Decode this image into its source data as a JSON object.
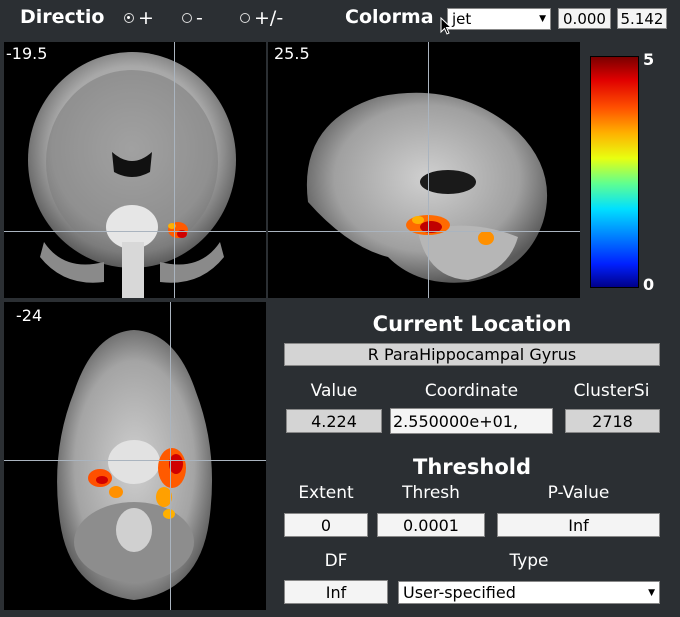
{
  "toolbar": {
    "direction_label": "Directio",
    "direction_options": [
      {
        "label": "+",
        "selected": true
      },
      {
        "label": "-",
        "selected": false
      },
      {
        "label": "+/-",
        "selected": false
      }
    ],
    "colormap_label": "Colorma",
    "colormap_value": "jet",
    "range_min": "0.000",
    "range_max": "5.142"
  },
  "views": {
    "coronal_label": "-19.5",
    "sagittal_label": "25.5",
    "axial_label": "-24"
  },
  "colorbar": {
    "max_label": "5",
    "min_label": "0",
    "colormap": "jet"
  },
  "location": {
    "title": "Current Location",
    "region": "R ParaHippocampal Gyrus",
    "value_label": "Value",
    "coordinate_label": "Coordinate",
    "cluster_label": "ClusterSi",
    "value": "4.224",
    "coordinate": "2.550000e+01,",
    "cluster_size": "2718"
  },
  "threshold": {
    "title": "Threshold",
    "extent_label": "Extent",
    "thresh_label": "Thresh",
    "pvalue_label": "P-Value",
    "extent": "0",
    "thresh": "0.0001",
    "pvalue": "Inf",
    "df_label": "DF",
    "type_label": "Type",
    "df": "Inf",
    "type": "User-specified"
  },
  "colors": {
    "background": "#2b2f33",
    "crosshair": "#aab4bf"
  }
}
